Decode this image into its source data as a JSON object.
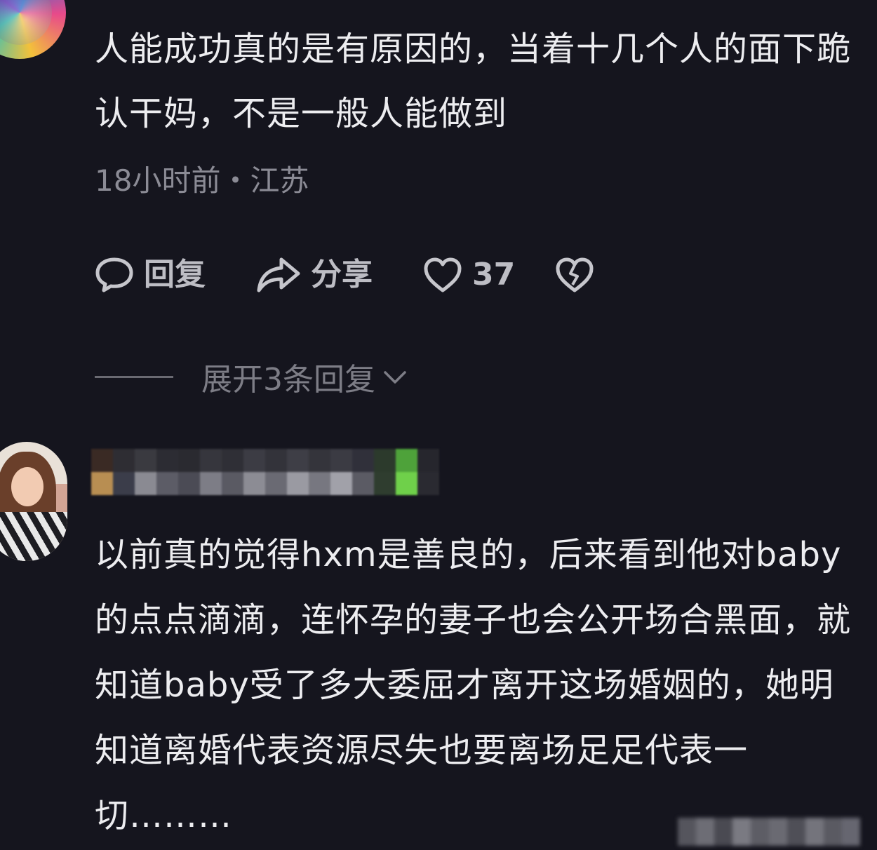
{
  "comment1": {
    "text": "人能成功真的是有原因的，当着十几个人的面下跪认干妈，不是一般人能做到",
    "meta": "18小时前・江苏",
    "actions": {
      "reply_label": "回复",
      "share_label": "分享",
      "like_count": "37"
    },
    "expand_label": "展开3条回复"
  },
  "comment2": {
    "text": "以前真的觉得hxm是善良的，后来看到他对baby的点点滴滴，连怀孕的妻子也会公开场合黑面，就知道baby受了多大委屈才离开这场婚姻的，她明知道离婚代表资源尽失也要离场足足代表一切………"
  },
  "icons": {
    "reply": "comment-bubble-icon",
    "share": "share-arrow-icon",
    "like": "heart-icon",
    "dislike": "broken-heart-icon",
    "expand": "chevron-down-icon"
  },
  "colors": {
    "background": "#15151e",
    "text_primary": "#ededf0",
    "text_secondary": "#8b8b95",
    "action_color": "#bdbdc4"
  }
}
